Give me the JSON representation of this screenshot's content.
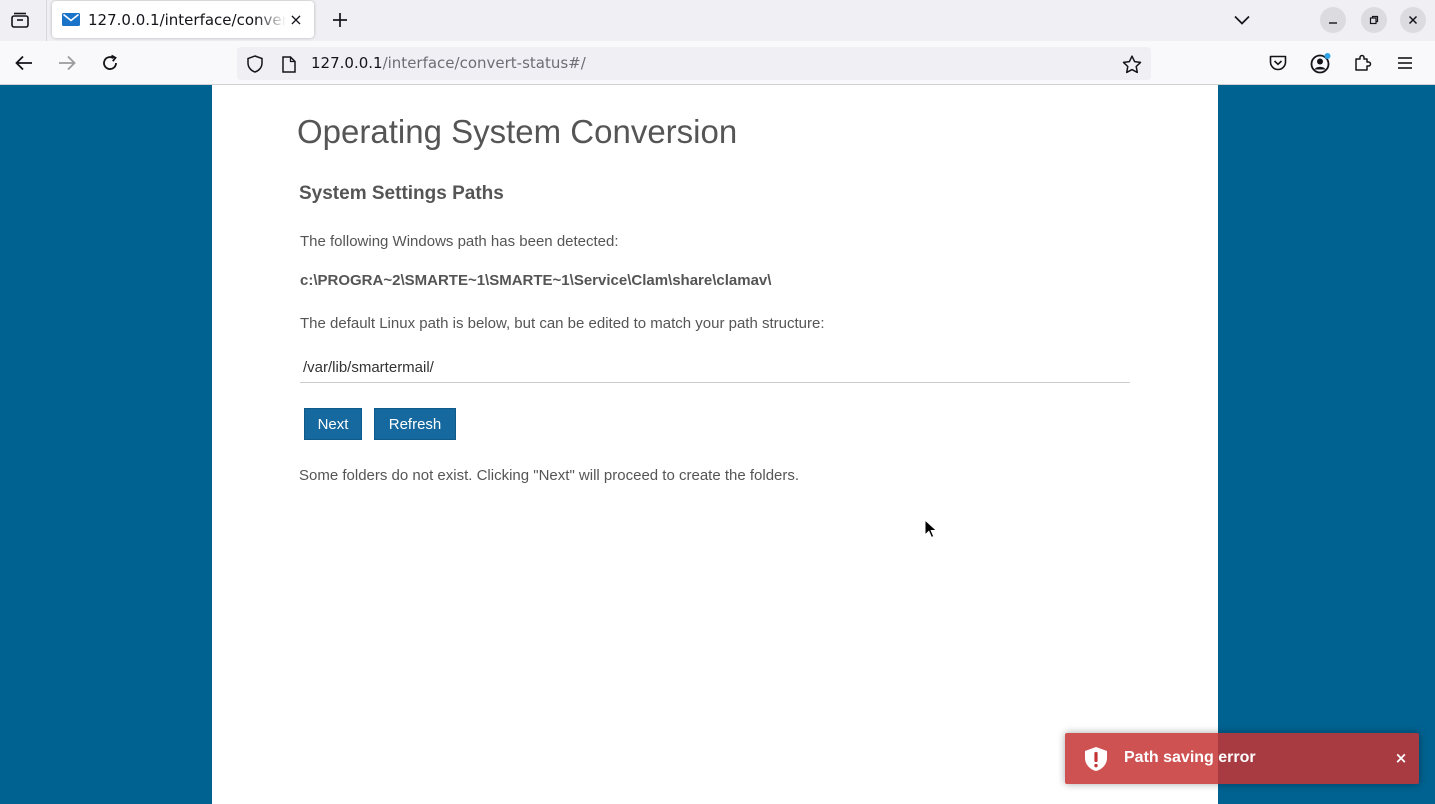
{
  "browser": {
    "tab": {
      "title": "127.0.0.1/interface/convert-status#/",
      "favicon": "envelope-icon",
      "close_glyph": "×"
    },
    "url": {
      "host": "127.0.0.1",
      "path": "/interface/convert-status#/"
    },
    "icons": {
      "tab_overview": "tab-overview-icon",
      "new_tab": "plus-icon",
      "list_tabs": "chevron-down-icon",
      "minimize": "minimize-icon",
      "restore": "restore-icon",
      "close_window": "close-icon",
      "back": "back-arrow-icon",
      "forward": "forward-arrow-icon",
      "reload": "reload-icon",
      "tracking_protection": "shield-icon",
      "page_info": "page-icon",
      "bookmark": "star-icon",
      "pocket": "pocket-icon",
      "account": "account-icon",
      "extensions": "puzzle-icon",
      "menu": "hamburger-menu-icon"
    }
  },
  "page": {
    "title": "Operating System Conversion",
    "section_title": "System Settings Paths",
    "detected_label": "The following Windows path has been detected:",
    "windows_path": "c:\\PROGRA~2\\SMARTE~1\\SMARTE~1\\Service\\Clam\\share\\clamav\\",
    "linux_label": "The default Linux path is below, but can be edited to match your path structure:",
    "linux_path_value": "/var/lib/smartermail/",
    "buttons": {
      "next": "Next",
      "refresh": "Refresh"
    },
    "note": "Some folders do not exist. Clicking \"Next\" will proceed to create the folders."
  },
  "toast": {
    "icon": "shield-alert-icon",
    "message": "Path saving error",
    "close_glyph": "×"
  },
  "colors": {
    "background": "#006290",
    "button": "#16699e",
    "toast": "#c53434",
    "text": "#555555"
  }
}
